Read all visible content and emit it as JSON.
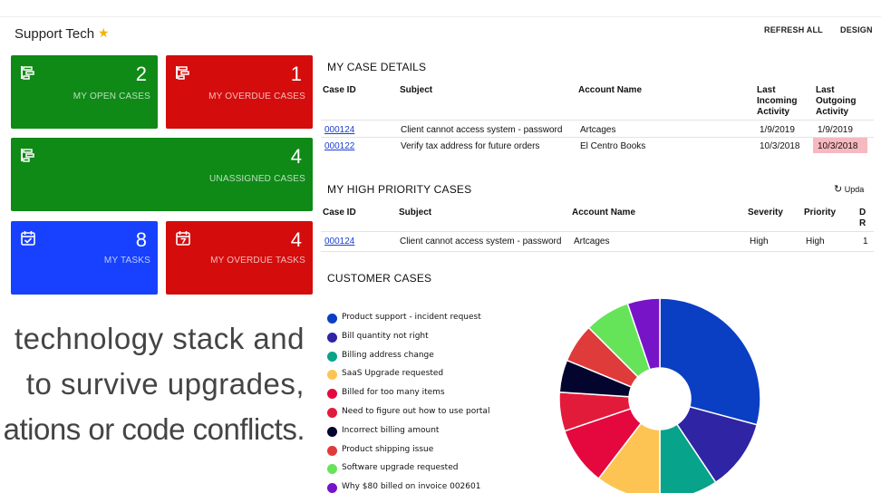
{
  "header": {
    "title": "Support Tech",
    "refresh_label": "REFRESH ALL",
    "design_label": "DESIGN"
  },
  "tiles": [
    {
      "count": "2",
      "label": "MY OPEN CASES",
      "color": "#0f8a17",
      "icon": "case-list-icon"
    },
    {
      "count": "1",
      "label": "MY OVERDUE CASES",
      "color": "#d40c0c",
      "icon": "case-list-icon"
    },
    {
      "count": "4",
      "label": "UNASSIGNED CASES",
      "color": "#0f8a17",
      "icon": "case-list-icon"
    },
    {
      "count": "8",
      "label": "MY TASKS",
      "color": "#1741ff",
      "icon": "calendar-check-icon"
    },
    {
      "count": "4",
      "label": "MY OVERDUE TASKS",
      "color": "#d40c0c",
      "icon": "calendar-7-icon"
    }
  ],
  "my_case_details": {
    "title": "MY CASE DETAILS",
    "headers": [
      "Case ID",
      "Subject",
      "Account Name",
      "Last Incoming Activity",
      "Last Outgoing Activity"
    ],
    "rows": [
      [
        "000124",
        "Client cannot access system - password",
        "Artcages",
        "1/9/2019",
        "1/9/2019"
      ],
      [
        "000122",
        "Verify tax address for future orders",
        "El Centro Books",
        "10/3/2018",
        "10/3/2018"
      ]
    ]
  },
  "high_priority": {
    "title": "MY HIGH PRIORITY CASES",
    "update_label": "Upda",
    "headers": [
      "Case ID",
      "Subject",
      "Account Name",
      "Severity",
      "Priority",
      "D R"
    ],
    "rows": [
      [
        "000124",
        "Client cannot access system - password",
        "Artcages",
        "High",
        "High",
        "1"
      ]
    ]
  },
  "customer_cases": {
    "title": "CUSTOMER CASES"
  },
  "chart_data": {
    "type": "pie",
    "categories": [
      "Product support - incident request",
      "Bill quantity not right",
      "Billing address change",
      "SaaS Upgrade requested",
      "Billed for too many items",
      "Need to figure out how to use portal",
      "Incorrect billing amount",
      "Product shipping issue",
      "Software upgrade requested",
      "Why $80 billed on invoice 002601"
    ],
    "values": [
      28,
      11,
      9,
      10,
      9,
      6,
      5,
      6,
      7,
      5
    ],
    "colors": [
      "#0a3fc4",
      "#2e24a4",
      "#07a38a",
      "#fdc453",
      "#e4083f",
      "#e31b3b",
      "#04052e",
      "#e03b3b",
      "#65e45a",
      "#7714c8"
    ],
    "legend_position": "left",
    "donut": true
  },
  "overlay": {
    "line1": "technology stack and",
    "line2": "to survive upgrades,",
    "line3": "ations or code conflicts."
  }
}
